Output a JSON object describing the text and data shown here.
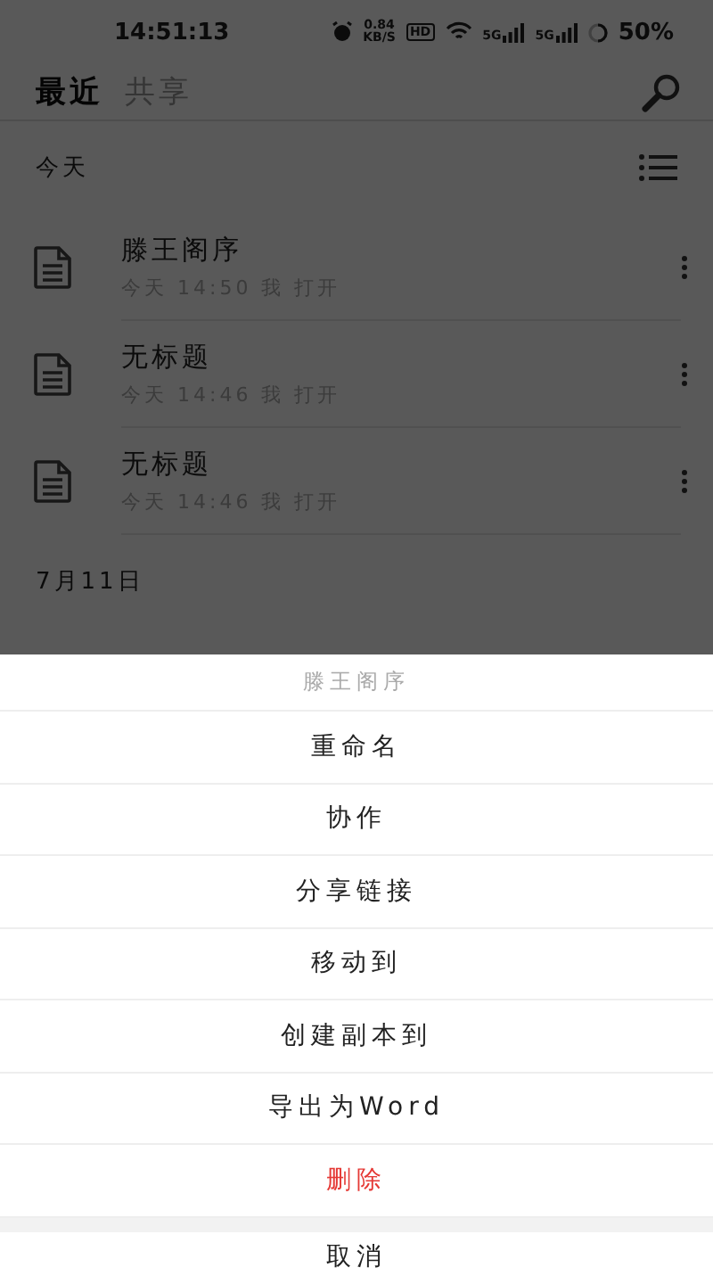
{
  "status_bar": {
    "time": "14:51:13",
    "speed_value": "0.84",
    "speed_unit": "KB/S",
    "hd": "HD",
    "networks": [
      "5G",
      "5G"
    ],
    "battery": "50%"
  },
  "tabs": [
    {
      "label": "最近",
      "selected": true
    },
    {
      "label": "共享",
      "selected": false
    }
  ],
  "sections": [
    {
      "title": "今天",
      "files": [
        {
          "name": "滕王阁序",
          "meta": "今天 14:50 我 打开"
        },
        {
          "name": "无标题",
          "meta": "今天 14:46 我 打开"
        },
        {
          "name": "无标题",
          "meta": "今天 14:46 我 打开"
        }
      ]
    },
    {
      "title": "7月11日"
    }
  ],
  "sheet": {
    "title": "滕王阁序",
    "actions": [
      {
        "label": "重命名",
        "kind": "normal"
      },
      {
        "label": "协作",
        "kind": "normal"
      },
      {
        "label": "分享链接",
        "kind": "normal"
      },
      {
        "label": "移动到",
        "kind": "normal"
      },
      {
        "label": "创建副本到",
        "kind": "normal"
      },
      {
        "label": "导出为Word",
        "kind": "normal"
      },
      {
        "label": "删除",
        "kind": "danger"
      }
    ],
    "cancel": "取消"
  }
}
